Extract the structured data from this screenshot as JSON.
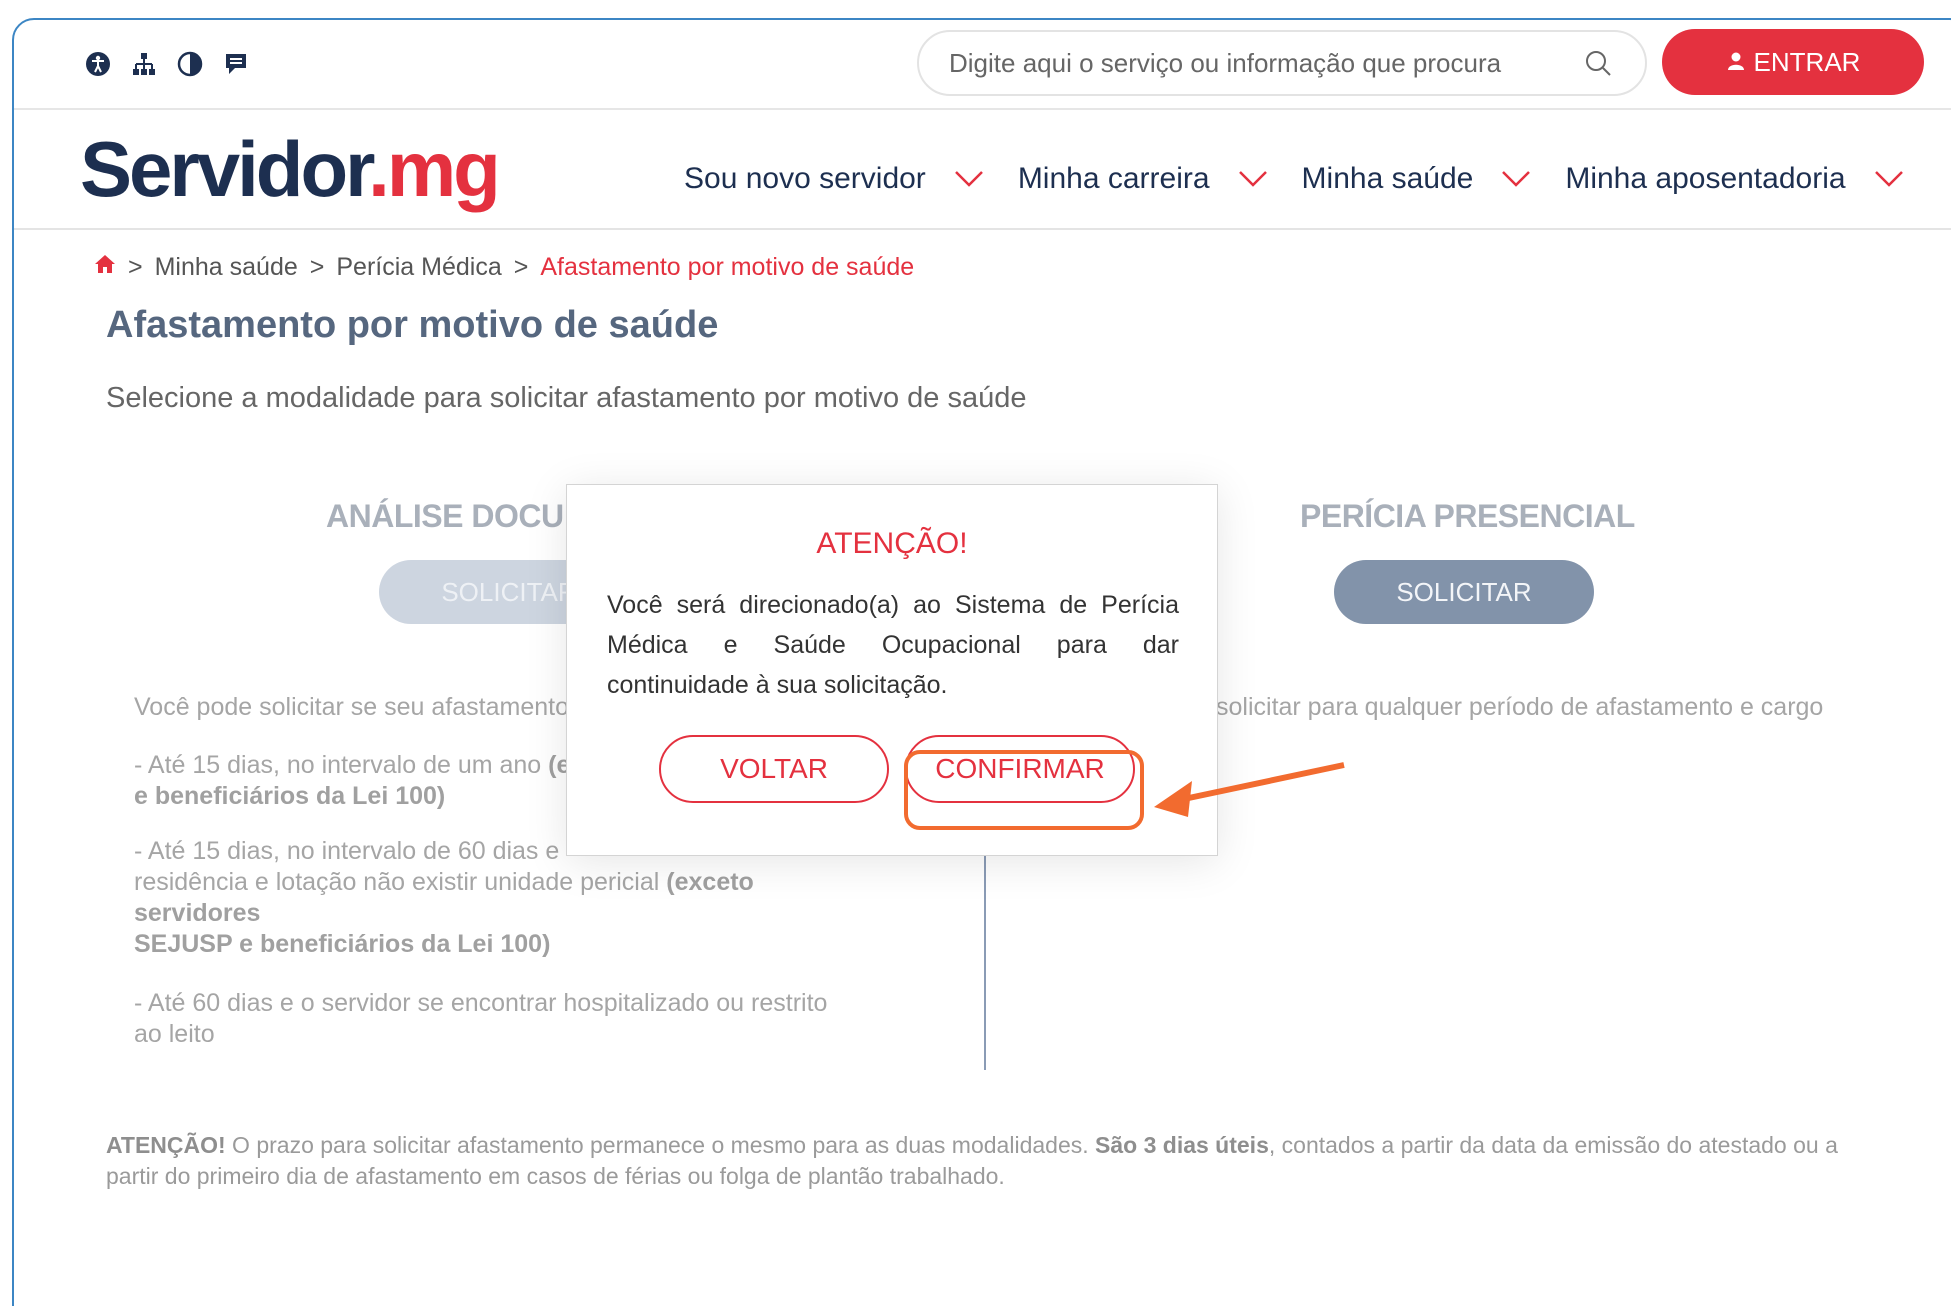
{
  "colors": {
    "accent": "#e4313f",
    "brand_dark": "#1d2f50",
    "annotation": "#f26b2f"
  },
  "header": {
    "accessibility_icons": [
      "accessibility-icon",
      "sitemap-icon",
      "contrast-icon",
      "chat-icon"
    ],
    "search": {
      "placeholder": "Digite aqui o serviço ou informação que procura",
      "icon": "search-icon"
    },
    "login_label": "ENTRAR",
    "login_icon": "user-icon"
  },
  "nav": {
    "logo_part1": "Servidor",
    "logo_part2": ".mg",
    "items": [
      {
        "label": "Sou novo servidor"
      },
      {
        "label": "Minha carreira"
      },
      {
        "label": "Minha saúde"
      },
      {
        "label": "Minha aposentadoria"
      }
    ]
  },
  "breadcrumb": {
    "home_icon": "home-icon",
    "separator": ">",
    "items": [
      "Minha saúde",
      "Perícia Médica"
    ],
    "current": "Afastamento por motivo de saúde"
  },
  "page": {
    "title": "Afastamento por motivo de saúde",
    "subtitle": "Selecione a modalidade para solicitar afastamento por motivo de saúde"
  },
  "left_column": {
    "title": "ANÁLISE DOCU",
    "button": "SOLICITAR",
    "intro": "Você pode solicitar se seu afastamento",
    "item1_a": "- Até 15 dias, no intervalo de um ano",
    "item1_b_bold": "(e",
    "item1_c": "e beneficiários da Lei 100)",
    "item2_a": "- Até 15 dias, no intervalo de 60 dias e",
    "item2_b": "residência e lotação não existir unidade pericial",
    "item2_bold": "(exceto servidores",
    "item2_c": "SEJUSP e beneficiários da Lei 100)",
    "item3_a": "- Até 60 dias e o servidor se encontrar hospitalizado ou restrito",
    "item3_b": "ao leito"
  },
  "right_column": {
    "title": "PERÍCIA PRESENCIAL",
    "button": "SOLICITAR",
    "intro": "solicitar para qualquer período de afastamento e cargo"
  },
  "footer_note": {
    "label": "ATENÇÃO!",
    "text1": " O prazo para solicitar afastamento permanece o mesmo para as duas modalidades. ",
    "bold": "São 3 dias úteis",
    "text2": ", contados a partir da data da emissão do atestado ou a partir do primeiro dia de afastamento em casos de férias ou folga de plantão trabalhado."
  },
  "modal": {
    "title": "ATENÇÃO!",
    "body": "Você será direcionado(a) ao Sistema de Perícia Médica e Saúde Ocupacional para dar continuidade à sua solicitação.",
    "back_label": "VOLTAR",
    "confirm_label": "CONFIRMAR"
  }
}
